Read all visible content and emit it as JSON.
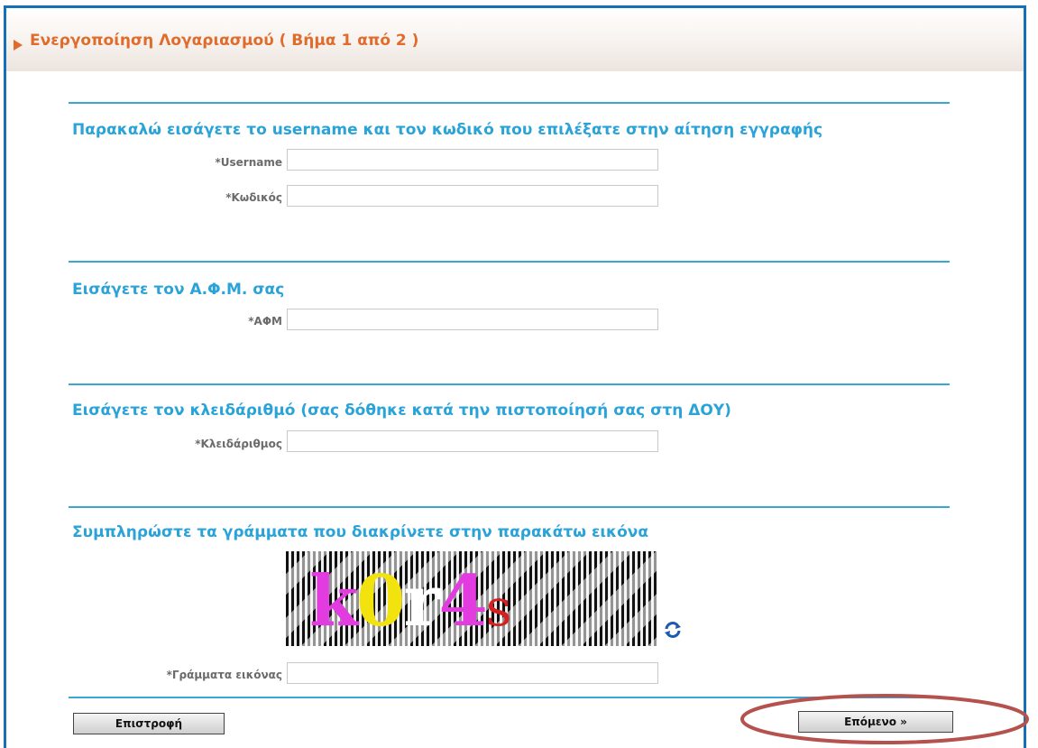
{
  "header": {
    "title": "Ενεργοποίηση Λογαριασμού ( Βήμα 1 από 2 )"
  },
  "sections": {
    "credentials": {
      "title": "Παρακαλώ εισάγετε το username και τον κωδικό που επιλέξατε στην αίτηση εγγραφής",
      "username_label": "*Username",
      "username_value": "",
      "password_label": "*Κωδικός",
      "password_value": ""
    },
    "afm": {
      "title": "Εισάγετε τον Α.Φ.Μ. σας",
      "afm_label": "*ΑΦΜ",
      "afm_value": ""
    },
    "key": {
      "title": "Εισάγετε τον κλειδάριθμό (σας δόθηκε κατά την πιστοποίησή σας στη ΔΟΥ)",
      "key_label": "*Κλειδάριθμος",
      "key_value": ""
    },
    "captcha": {
      "title": "Συμπληρώστε τα γράμματα που διακρίνετε στην παρακάτω εικόνα",
      "image_chars": [
        "k",
        "0",
        "r",
        "4",
        "s"
      ],
      "image_colors": [
        "#e23be0",
        "#f2e20e",
        "#ffffff",
        "#e23be0",
        "#d42020"
      ],
      "input_label": "*Γράμματα εικόνας",
      "input_value": ""
    }
  },
  "buttons": {
    "back": "Επιστροφή",
    "next": "Επόμενο »"
  },
  "colors": {
    "border": "#1570b8",
    "header_text": "#e06b2b",
    "section_title": "#2aa3d8",
    "highlight": "#b5524e"
  },
  "icons": {
    "refresh": "refresh-icon",
    "header_arrow": "play-arrow-icon"
  }
}
